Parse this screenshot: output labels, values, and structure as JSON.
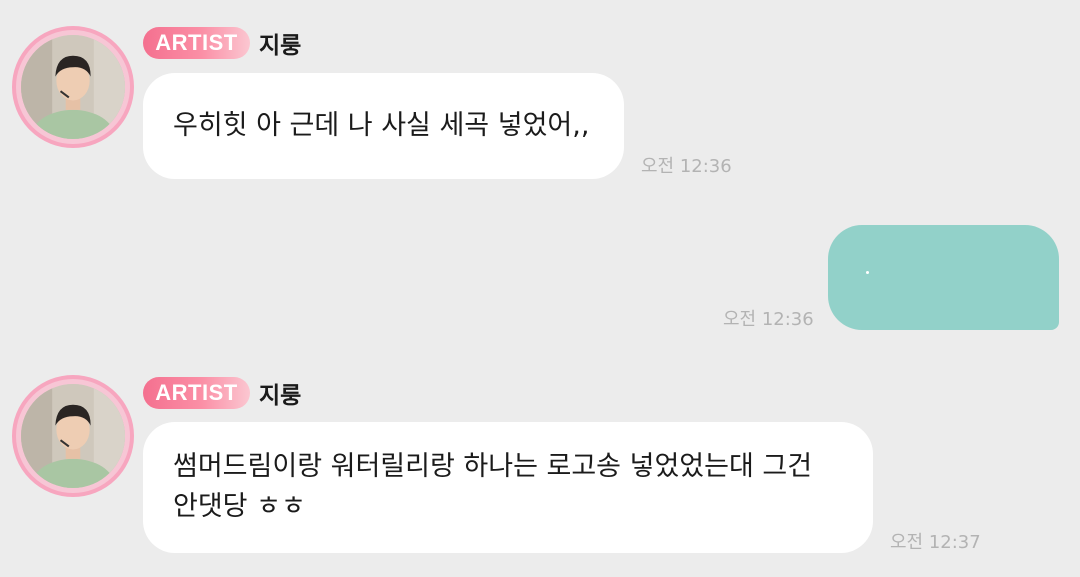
{
  "messages": [
    {
      "badge": "ARTIST",
      "sender": "지룽",
      "lines": [
        "우히힛 아 근데 나 사실 세곡 넣었어,,"
      ],
      "time": "오전 12:36"
    },
    {
      "time": "오전 12:36",
      "bubble_color": "#92d1c9"
    },
    {
      "badge": "ARTIST",
      "sender": "지룽",
      "lines": [
        "썸머드림이랑 워터릴리랑 하나는 로고송 넣었었는대 그건",
        "안댓당 ㅎㅎ"
      ],
      "time": "오전 12:37"
    }
  ],
  "colors": {
    "background": "#ececec",
    "bubble": "#ffffff",
    "badge_start": "#f4708f",
    "badge_end": "#fbc7d1",
    "avatar_ring": "#f7a6bf",
    "my_bubble": "#92d1c9",
    "time_text": "#b3b3b3"
  }
}
